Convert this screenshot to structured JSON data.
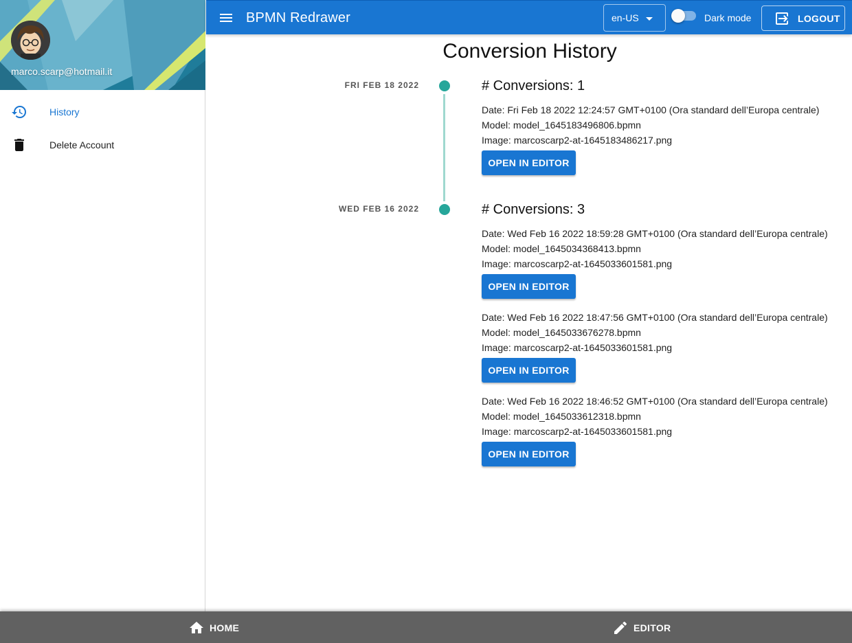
{
  "app": {
    "title": "BPMN Redrawer",
    "language": "en-US",
    "dark_mode_label": "Dark mode",
    "dark_mode_on": false,
    "logout_label": "LOGOUT"
  },
  "sidebar": {
    "user_email": "marco.scarp@hotmail.it",
    "items": [
      {
        "label": "History",
        "icon": "history-icon",
        "active": true
      },
      {
        "label": "Delete Account",
        "icon": "trash-icon",
        "active": false
      }
    ]
  },
  "main": {
    "title": "Conversion History",
    "groups": [
      {
        "date": "FRI FEB 18 2022",
        "title": "# Conversions: 1",
        "entries": [
          {
            "date": "Date: Fri Feb 18 2022 12:24:57 GMT+0100 (Ora standard dell’Europa centrale)",
            "model": "Model: model_1645183496806.bpmn",
            "image": "Image: marcoscarp2-at-1645183486217.png",
            "button": "OPEN IN EDITOR"
          }
        ]
      },
      {
        "date": "WED FEB 16 2022",
        "title": "# Conversions: 3",
        "entries": [
          {
            "date": "Date: Wed Feb 16 2022 18:59:28 GMT+0100 (Ora standard dell’Europa centrale)",
            "model": "Model: model_1645034368413.bpmn",
            "image": "Image: marcoscarp2-at-1645033601581.png",
            "button": "OPEN IN EDITOR"
          },
          {
            "date": "Date: Wed Feb 16 2022 18:47:56 GMT+0100 (Ora standard dell’Europa centrale)",
            "model": "Model: model_1645033676278.bpmn",
            "image": "Image: marcoscarp2-at-1645033601581.png",
            "button": "OPEN IN EDITOR"
          },
          {
            "date": "Date: Wed Feb 16 2022 18:46:52 GMT+0100 (Ora standard dell’Europa centrale)",
            "model": "Model: model_1645033612318.bpmn",
            "image": "Image: marcoscarp2-at-1645033601581.png",
            "button": "OPEN IN EDITOR"
          }
        ]
      }
    ]
  },
  "bottom_nav": {
    "home_label": "HOME",
    "editor_label": "EDITOR"
  },
  "colors": {
    "primary": "#1976d2",
    "timeline_dot": "#26a69a",
    "bottom_bar": "#616161"
  }
}
